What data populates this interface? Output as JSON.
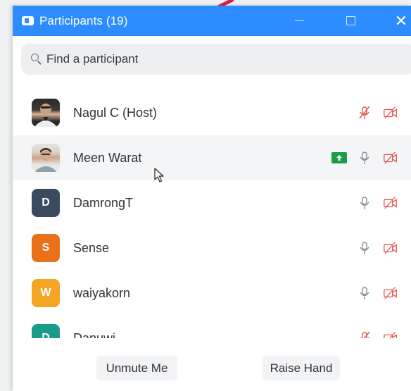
{
  "window": {
    "title": "Participants (19)",
    "accent": "#2d8cff"
  },
  "search": {
    "placeholder": "Find a participant"
  },
  "participants": [
    {
      "name": "Nagul C (Host)",
      "avatar_type": "photo",
      "mic": "muted",
      "video": "off",
      "sharing": false
    },
    {
      "name": "Meen Warat",
      "avatar_type": "photo",
      "mic": "on",
      "video": "off",
      "sharing": true
    },
    {
      "name": "DamrongT",
      "avatar_type": "initial",
      "initial": "D",
      "avatar_color": "#3b4a5e",
      "mic": "on",
      "video": "off",
      "sharing": false
    },
    {
      "name": "Sense",
      "avatar_type": "initial",
      "initial": "S",
      "avatar_color": "#e8711a",
      "mic": "on",
      "video": "off",
      "sharing": false
    },
    {
      "name": "waiyakorn",
      "avatar_type": "initial",
      "initial": "W",
      "avatar_color": "#f5a524",
      "mic": "on",
      "video": "off",
      "sharing": false
    },
    {
      "name": "Danuwi",
      "avatar_type": "initial",
      "initial": "D",
      "avatar_color": "#1b9b8a",
      "mic": "muted",
      "video": "off",
      "sharing": false
    }
  ],
  "footer": {
    "unmute_label": "Unmute Me",
    "raise_hand_label": "Raise Hand"
  },
  "icons": {
    "muted_color": "#e0554f",
    "mic_color": "#8a8d91",
    "share_color": "#1a9e47"
  }
}
